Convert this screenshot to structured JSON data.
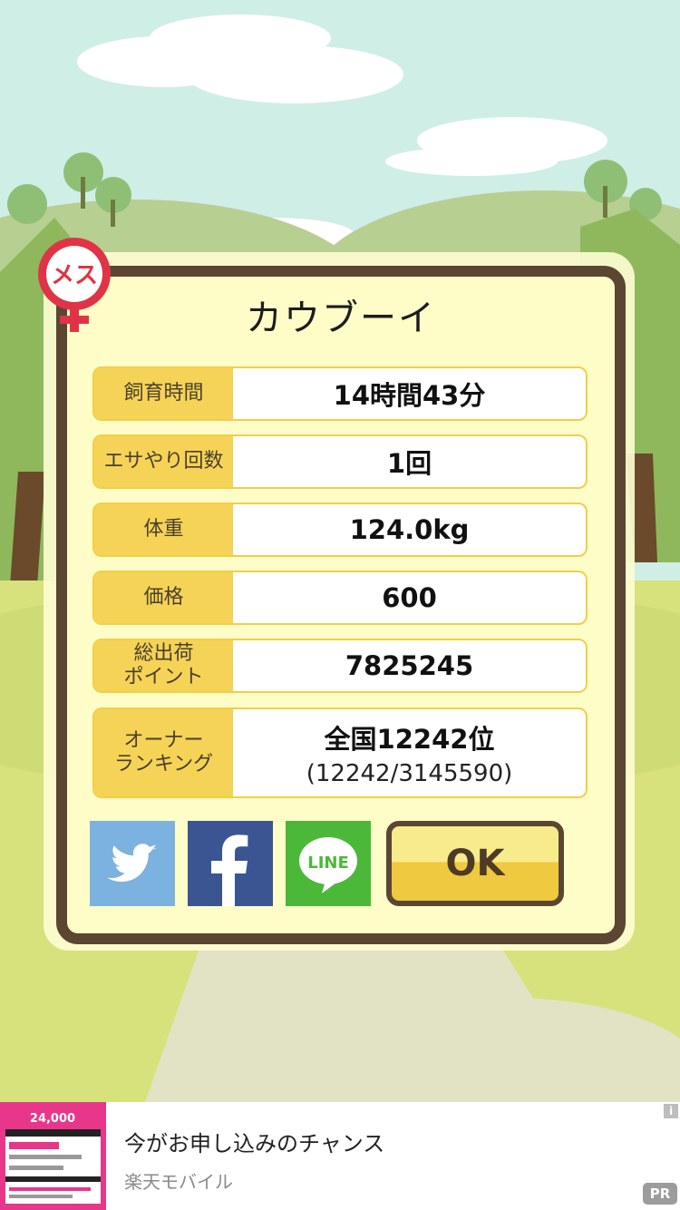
{
  "dialog": {
    "badge_label": "メス",
    "title": "カウブーイ",
    "rows": [
      {
        "label": "飼育時間",
        "value": "14時間43分"
      },
      {
        "label": "エサやり回数",
        "value": "1回"
      },
      {
        "label": "体重",
        "value": "124.0kg"
      },
      {
        "label": "価格",
        "value": "600"
      },
      {
        "label": "総出荷\nポイント",
        "value": "7825245"
      }
    ],
    "ranking": {
      "label": "オーナー\nランキング",
      "value": "全国12242位",
      "sub": "(12242/3145590)"
    },
    "share": {
      "twitter_icon": "twitter-bird-icon",
      "facebook_icon": "facebook-f-icon",
      "line_label": "LINE"
    },
    "ok_label": "OK"
  },
  "ad": {
    "title": "今がお申し込みのチャンス",
    "sponsor": "楽天モバイル",
    "info_icon": "i",
    "pr_label": "PR",
    "thumb_text": "24,000"
  },
  "colors": {
    "frame": "#5b4632",
    "panel": "#fefdc8",
    "label_bg": "#f5d356",
    "sky": "#cfeee6",
    "grass": "#d7e27c"
  }
}
